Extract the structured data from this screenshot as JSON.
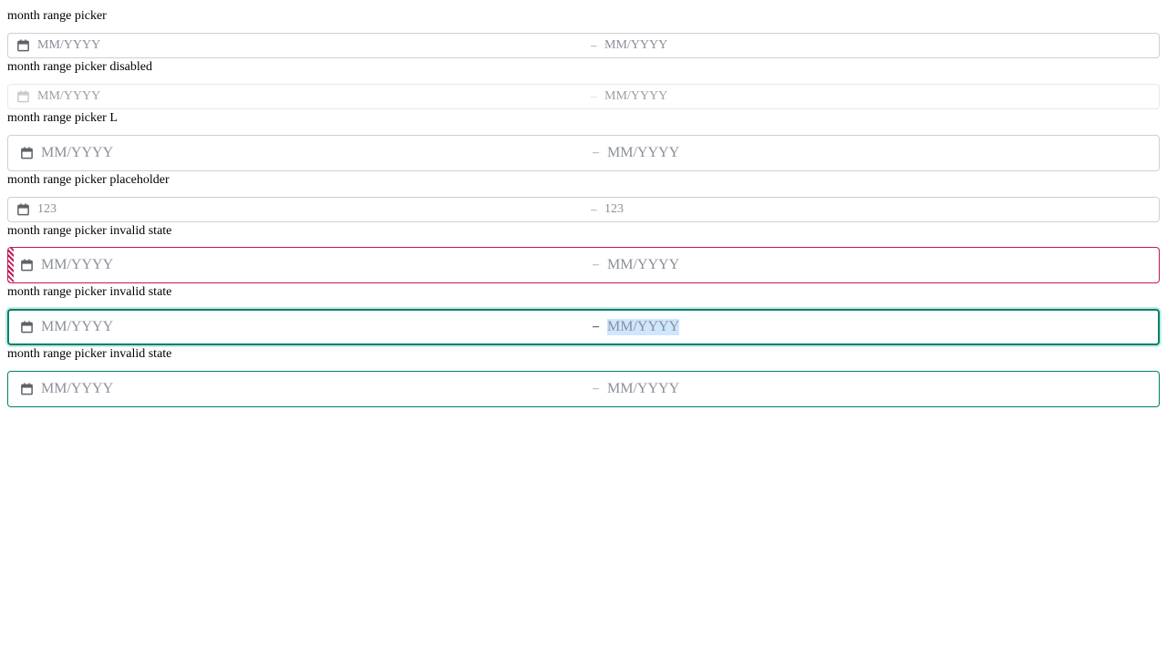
{
  "colors": {
    "border": "#cfcfcf",
    "disabled_border": "#e8e8e8",
    "invalid": "#c2185b",
    "focus": "#00806a",
    "placeholder": "#8a8f99",
    "icon": "#5f6368",
    "icon_disabled": "#c9ccd1"
  },
  "pickers": [
    {
      "label": "month range picker",
      "icon": "calendar-icon",
      "start": "MM/YYYY",
      "separator": "–",
      "end": "MM/YYYY"
    },
    {
      "label": "month range picker disabled",
      "icon": "calendar-icon",
      "start": "MM/YYYY",
      "separator": "–",
      "end": "MM/YYYY"
    },
    {
      "label": "month range picker L",
      "icon": "calendar-icon",
      "start": "MM/YYYY",
      "separator": "–",
      "end": "MM/YYYY"
    },
    {
      "label": "month range picker placeholder",
      "icon": "calendar-icon",
      "start": "123",
      "separator": "–",
      "end": "123"
    },
    {
      "label": "month range picker invalid state",
      "icon": "calendar-icon",
      "start": "MM/YYYY",
      "separator": "–",
      "end": "MM/YYYY"
    },
    {
      "label": "month range picker invalid state",
      "icon": "calendar-icon",
      "start": "MM/YYYY",
      "separator": "–",
      "end": "MM/YYYY"
    },
    {
      "label": "month range picker invalid state",
      "icon": "calendar-icon",
      "start": "MM/YYYY",
      "separator": "–",
      "end": "MM/YYYY"
    }
  ]
}
